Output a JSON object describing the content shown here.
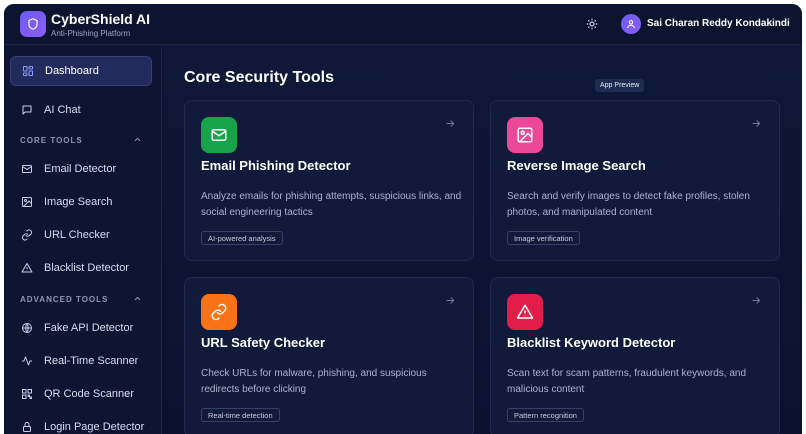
{
  "app": {
    "name": "CyberShield AI",
    "subtitle": "Anti-Phishing Platform"
  },
  "header": {
    "user_name": "Sai Charan Reddy Kondakindi"
  },
  "sidebar": {
    "top_items": [
      {
        "label": "Dashboard",
        "icon": "dashboard-icon",
        "active": true
      },
      {
        "label": "AI Chat",
        "icon": "chat-icon"
      }
    ],
    "core_tools": {
      "heading": "CORE TOOLS",
      "items": [
        {
          "label": "Email Detector",
          "icon": "mail-icon"
        },
        {
          "label": "Image Search",
          "icon": "image-icon"
        },
        {
          "label": "URL Checker",
          "icon": "link-icon"
        },
        {
          "label": "Blacklist Detector",
          "icon": "warning-icon"
        }
      ]
    },
    "advanced_tools": {
      "heading": "ADVANCED TOOLS",
      "items": [
        {
          "label": "Fake API Detector",
          "icon": "globe-icon"
        },
        {
          "label": "Real-Time Scanner",
          "icon": "activity-icon"
        },
        {
          "label": "QR Code Scanner",
          "icon": "qr-icon"
        },
        {
          "label": "Login Page Detector",
          "icon": "lock-icon"
        }
      ]
    }
  },
  "main": {
    "title": "Core Security Tools",
    "preview_tag": "App Preview",
    "cards": [
      {
        "title": "Email Phishing Detector",
        "description": "Analyze emails for phishing attempts, suspicious links, and social engineering tactics",
        "badge": "AI-powered analysis",
        "icon": "mail-icon",
        "color": "#16a34a"
      },
      {
        "title": "Reverse Image Search",
        "description": "Search and verify images to detect fake profiles, stolen photos, and manipulated content",
        "badge": "Image verification",
        "icon": "image-icon",
        "color": "#ec4899"
      },
      {
        "title": "URL Safety Checker",
        "description": "Check URLs for malware, phishing, and suspicious redirects before clicking",
        "badge": "Real-time detection",
        "icon": "link-icon",
        "color": "#f97316"
      },
      {
        "title": "Blacklist Keyword Detector",
        "description": "Scan text for scam patterns, fraudulent keywords, and malicious content",
        "badge": "Pattern recognition",
        "icon": "warning-icon",
        "color": "#e11d48"
      }
    ]
  },
  "colors": {
    "accent": "#7c5cf6",
    "background": "#0b1230",
    "card": "#111a3b"
  }
}
